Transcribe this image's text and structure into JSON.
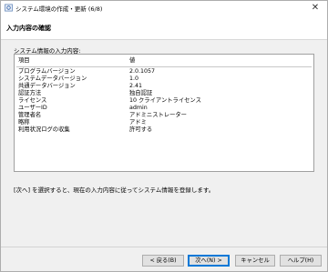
{
  "window": {
    "title": "システム環境の作成・更新 (6/8)",
    "app_icon": "app-gear-icon",
    "close_glyph": "✕"
  },
  "header": {
    "title": "入力内容の確認"
  },
  "info": {
    "label": "システム情報の入力内容:",
    "header_row": {
      "key": "項目",
      "value": "値"
    },
    "rows": [
      {
        "key": "プログラムバージョン",
        "value": "2.0.1057"
      },
      {
        "key": "システムデータバージョン",
        "value": "1.0"
      },
      {
        "key": "共通データバージョン",
        "value": "2.41"
      },
      {
        "key": "認証方法",
        "value": "独自認証"
      },
      {
        "key": "ライセンス",
        "value": "10 クライアントライセンス"
      },
      {
        "key": "ユーザーID",
        "value": "admin"
      },
      {
        "key": "管理者名",
        "value": "アドミニストレーター"
      },
      {
        "key": "略称",
        "value": "アドミ"
      },
      {
        "key": "利用状況ログの収集",
        "value": "許可する"
      }
    ]
  },
  "instruction": "[次へ] を選択すると、現在の入力内容に従ってシステム情報を登録します。",
  "buttons": {
    "back": "< 戻る(B)",
    "next": "次へ(N) >",
    "cancel": "キャンセル",
    "help": "ヘルプ(H)"
  }
}
